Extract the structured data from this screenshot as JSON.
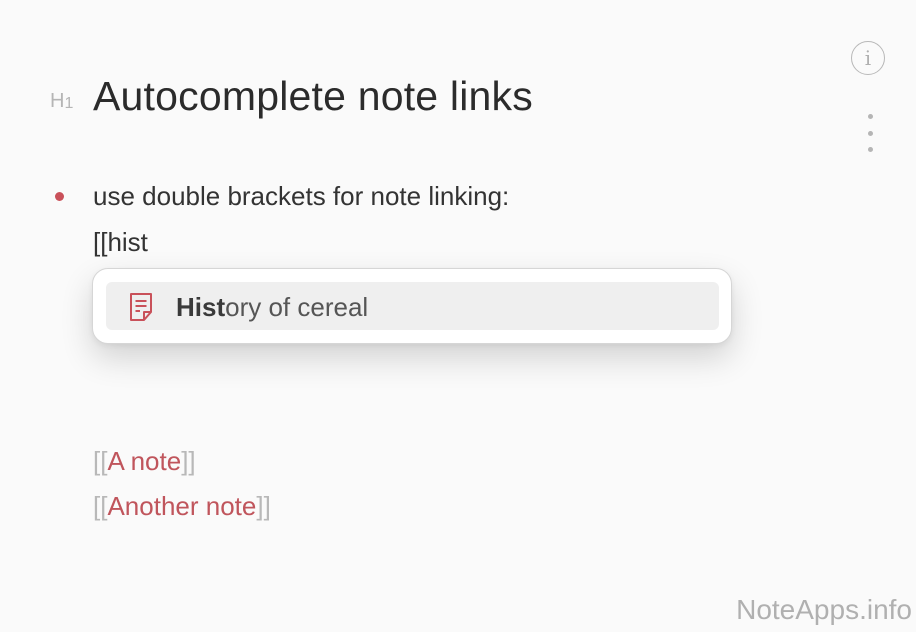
{
  "toolbar": {
    "info_icon": "info-icon",
    "info_glyph": "i",
    "more_icon": "more-vertical-icon"
  },
  "editor": {
    "heading_marker": "H",
    "heading_marker_level": "1",
    "title": "Autocomplete note links",
    "bullet_text": "use double brackets for note linking:",
    "typed_text": "[[hist"
  },
  "autocomplete": {
    "items": [
      {
        "icon": "note-icon",
        "match": "Hist",
        "rest": "ory of cereal"
      }
    ]
  },
  "links": [
    {
      "open": "[[",
      "text": "A note",
      "close": "]]"
    },
    {
      "open": "[[",
      "text": "Another note",
      "close": "]]"
    }
  ],
  "watermark": "NoteApps.info",
  "colors": {
    "accent": "#c9515a",
    "link_text": "#c0555c",
    "bracket": "#b8b8b8",
    "background": "#fafafa"
  }
}
